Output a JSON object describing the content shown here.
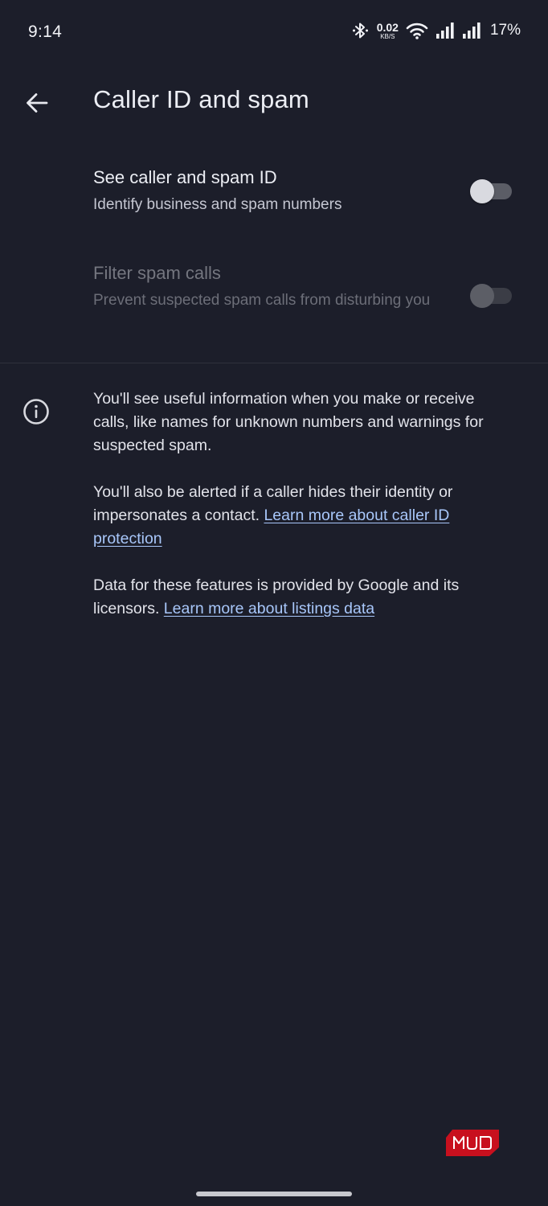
{
  "status_bar": {
    "time": "9:14",
    "net_speed_value": "0.02",
    "net_speed_unit": "KB/S",
    "battery": "17%",
    "icons": [
      "bluetooth-icon",
      "wifi-icon",
      "signal-icon",
      "signal-icon"
    ]
  },
  "app_bar": {
    "title": "Caller ID and spam",
    "back_icon": "arrow-back-icon"
  },
  "settings": [
    {
      "title": "See caller and spam ID",
      "summary": "Identify business and spam numbers",
      "enabled": true,
      "checked": false
    },
    {
      "title": "Filter spam calls",
      "summary": "Prevent suspected spam calls from disturbing you",
      "enabled": false,
      "checked": false
    }
  ],
  "info": {
    "icon": "info-icon",
    "p1": "You'll see useful information when you make or receive calls, like names for unknown numbers and warnings for suspected spam.",
    "p2_text": "You'll also be alerted if a caller hides their identity or impersonates a contact.",
    "p2_link": "Learn more about caller ID protection",
    "p3_text": "Data for these features is provided by Google and its licensors.",
    "p3_link": "Learn more about listings data"
  },
  "watermark": {
    "text": "MUO"
  },
  "colors": {
    "background": "#1c1e2a",
    "link": "#a8c7fa",
    "logo_red": "#c8101e"
  }
}
